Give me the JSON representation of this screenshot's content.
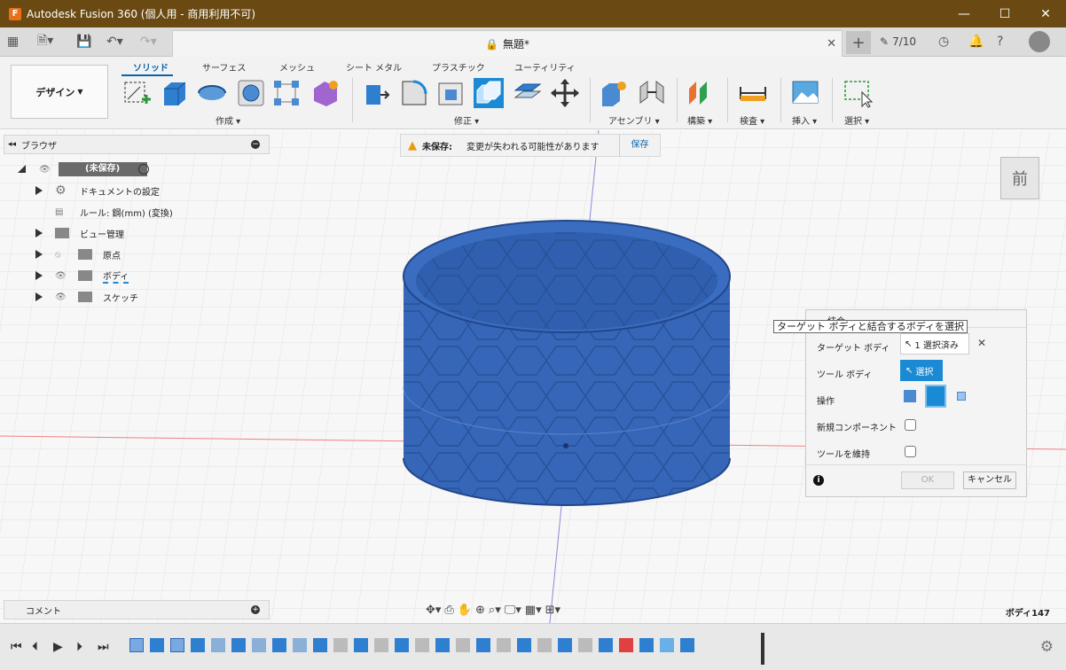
{
  "window": {
    "title": "Autodesk Fusion 360 (個人用 - 商用利用不可)",
    "app_icon_letter": "F",
    "controls": [
      "—",
      "☐",
      "✕"
    ]
  },
  "tabbar": {
    "doc_title": "無題*",
    "jobs": "7/10"
  },
  "ribbon": {
    "workspace": "デザイン",
    "tabs": [
      "ソリッド",
      "サーフェス",
      "メッシュ",
      "シート メタル",
      "プラスチック",
      "ユーティリティ"
    ],
    "groups": [
      "作成",
      "修正",
      "アセンブリ",
      "構築",
      "検査",
      "挿入",
      "選択"
    ]
  },
  "browser": {
    "title": "ブラウザ",
    "root": "(未保存)",
    "items": [
      "ドキュメントの設定",
      "ルール: 鋼(mm) (変換)",
      "ビュー管理",
      "原点",
      "ボディ",
      "スケッチ"
    ]
  },
  "warning": {
    "label": "未保存:",
    "message": "変更が失われる可能性があります",
    "action": "保存"
  },
  "viewcube": {
    "face": "前"
  },
  "comments": {
    "title": "コメント"
  },
  "status": {
    "selection": "ボディ147"
  },
  "dialog": {
    "title": "結合",
    "tooltip": "ターゲット ボディと結合するボディを選択",
    "target_label": "ターゲット ボディ",
    "target_value": "1 選択済み",
    "tool_label": "ツール ボディ",
    "tool_value": "選択",
    "operation_label": "操作",
    "new_component_label": "新規コンポーネント",
    "keep_tools_label": "ツールを維持",
    "ok": "OK",
    "cancel": "キャンセル"
  },
  "colors": {
    "body": "#3566b8",
    "accent": "#0a62a8",
    "titlebar": "#6a4a12",
    "select": "#1b8ad4"
  }
}
